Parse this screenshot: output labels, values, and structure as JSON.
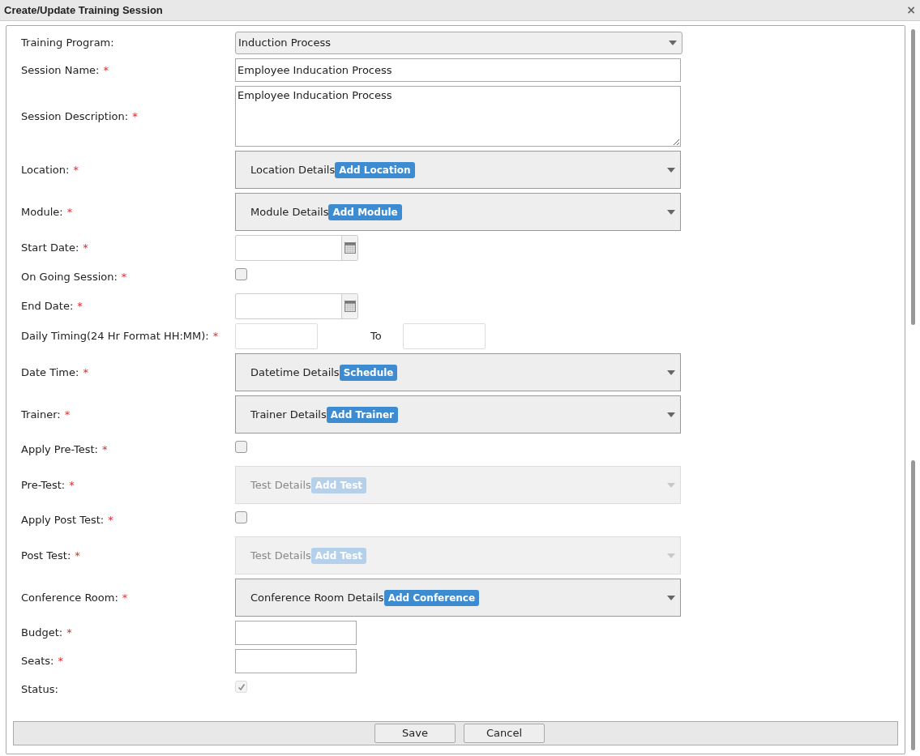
{
  "dialog": {
    "title": "Create/Update Training Session",
    "close": "×"
  },
  "fields": [
    {
      "kind": "select",
      "label": "Training Program:",
      "value": "Induction Process"
    },
    {
      "kind": "text",
      "label": "Session Name:",
      "required_mark": "*",
      "value": "Employee Inducation Process"
    },
    {
      "kind": "textarea",
      "label": "Session Description:",
      "required_mark": "*",
      "value": "Employee Inducation Process"
    },
    {
      "kind": "picker",
      "label": "Location:",
      "required_mark": "*",
      "text": "Location Details",
      "button": "Add Location",
      "disabled": false
    },
    {
      "kind": "picker",
      "label": "Module:",
      "required_mark": "*",
      "text": "Module Details",
      "button": "Add Module",
      "disabled": false
    },
    {
      "kind": "date",
      "label": "Start Date:",
      "required_mark": "*"
    },
    {
      "kind": "checkbox",
      "label": "On Going Session:",
      "required_mark": "*",
      "checked": false,
      "disabled": false
    },
    {
      "kind": "date",
      "label": "End Date:",
      "required_mark": "*"
    },
    {
      "kind": "timerange",
      "label": "Daily Timing(24 Hr Format HH:MM):",
      "required_mark": "*",
      "separator": "To"
    },
    {
      "kind": "picker",
      "label": "Date Time:",
      "required_mark": "*",
      "text": "Datetime Details",
      "button": "Schedule",
      "disabled": false
    },
    {
      "kind": "picker",
      "label": "Trainer:",
      "required_mark": "*",
      "text": "Trainer Details",
      "button": "Add Trainer",
      "disabled": false
    },
    {
      "kind": "checkbox",
      "label": "Apply Pre-Test:",
      "required_mark": "*",
      "checked": false,
      "disabled": false
    },
    {
      "kind": "picker",
      "label": "Pre-Test:",
      "required_mark": "*",
      "text": "Test Details",
      "button": "Add Test",
      "disabled": true
    },
    {
      "kind": "checkbox",
      "label": "Apply Post Test:",
      "required_mark": "*",
      "checked": false,
      "disabled": false
    },
    {
      "kind": "picker",
      "label": "Post Test:",
      "required_mark": "*",
      "text": "Test Details",
      "button": "Add Test",
      "disabled": true
    },
    {
      "kind": "picker",
      "label": "Conference Room:",
      "required_mark": "*",
      "text": "Conference Room Details",
      "button": "Add Conference",
      "disabled": false
    },
    {
      "kind": "short",
      "label": "Budget:",
      "required_mark": "*"
    },
    {
      "kind": "short",
      "label": "Seats:",
      "required_mark": "*"
    },
    {
      "kind": "checkbox",
      "label": "Status:",
      "checked": true,
      "disabled": true
    }
  ],
  "buttons": [
    "Save",
    "Cancel"
  ]
}
